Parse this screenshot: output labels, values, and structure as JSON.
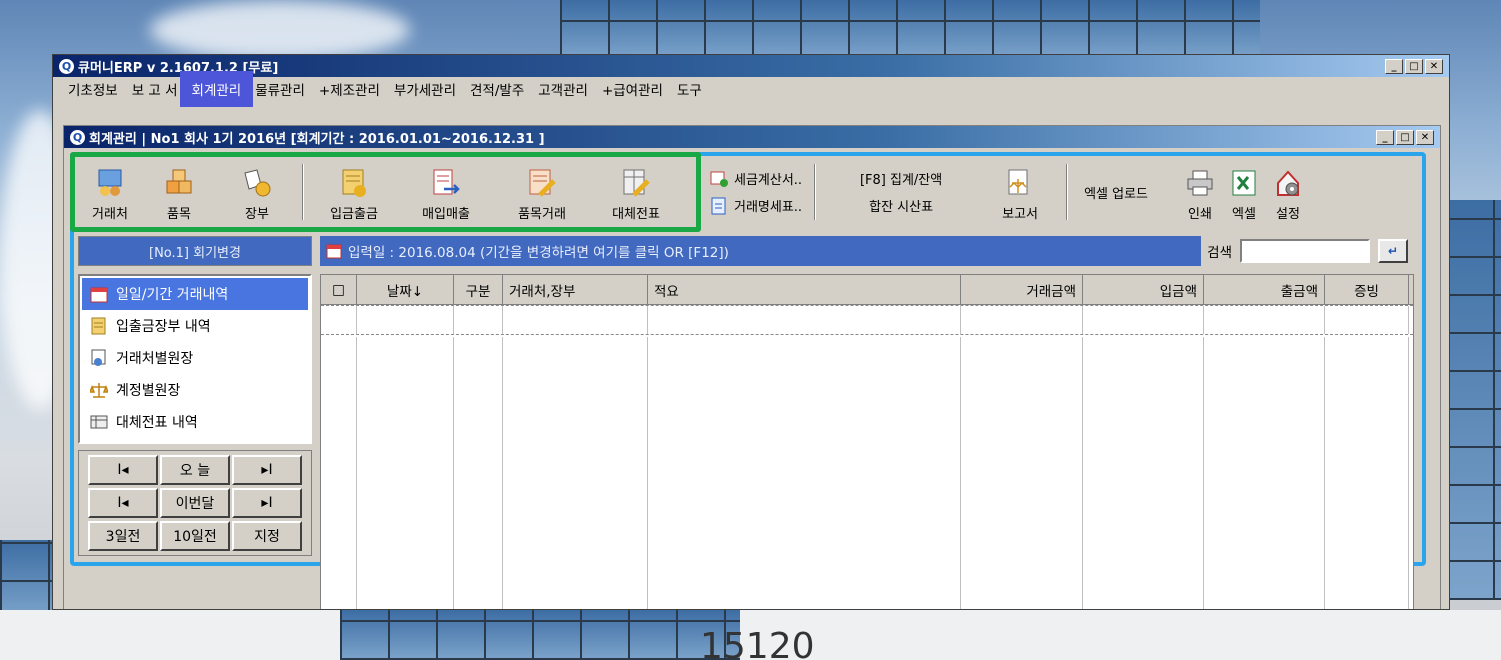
{
  "app": {
    "title": "큐머니ERP   v 2.1607.1.2 [무료]",
    "menu": [
      "기초정보",
      "보 고 서",
      "회계관리",
      "물류관리",
      "+제조관리",
      "부가세관리",
      "견적/발주",
      "고객관리",
      "+급여관리",
      "도구"
    ],
    "active_menu": "회계관리"
  },
  "child": {
    "title": "회계관리 | No1 회사 1기 2016년 [회계기간 : 2016.01.01~2016.12.31 ]"
  },
  "toolbar": {
    "group1": [
      "거래처",
      "품목",
      "장부"
    ],
    "group2": [
      "입금출금",
      "매입매출",
      "품목거래",
      "대체전표"
    ],
    "tax_invoice": "세금계산서..",
    "statement": "거래명세표..",
    "f8_summary": "[F8] 집계/잔액",
    "trial_balance": "합잔 시산표",
    "report": "보고서",
    "excel_upload": "엑셀 업로드",
    "print": "인쇄",
    "excel": "엑셀",
    "settings": "설정"
  },
  "left": {
    "period_change": "[No.1] 회기변경",
    "nav": [
      "일일/기간 거래내역",
      "입출금장부 내역",
      "거래처별원장",
      "계정별원장",
      "대체전표 내역"
    ],
    "selected_nav": 0,
    "date_buttons": [
      "I◂",
      "오 늘",
      "▸I",
      "I◂",
      "이번달",
      "▸I",
      "3일전",
      "10일전",
      "지정"
    ]
  },
  "right": {
    "info": "입력일 : 2016.08.04  (기간을 변경하려면 여기를 클릭 OR [F12])",
    "search_label": "검색",
    "search_value": "",
    "columns": [
      "□",
      "날짜↓",
      "구분",
      "거래처,장부",
      "적요",
      "거래금액",
      "입금액",
      "출금액",
      "증빙"
    ]
  }
}
